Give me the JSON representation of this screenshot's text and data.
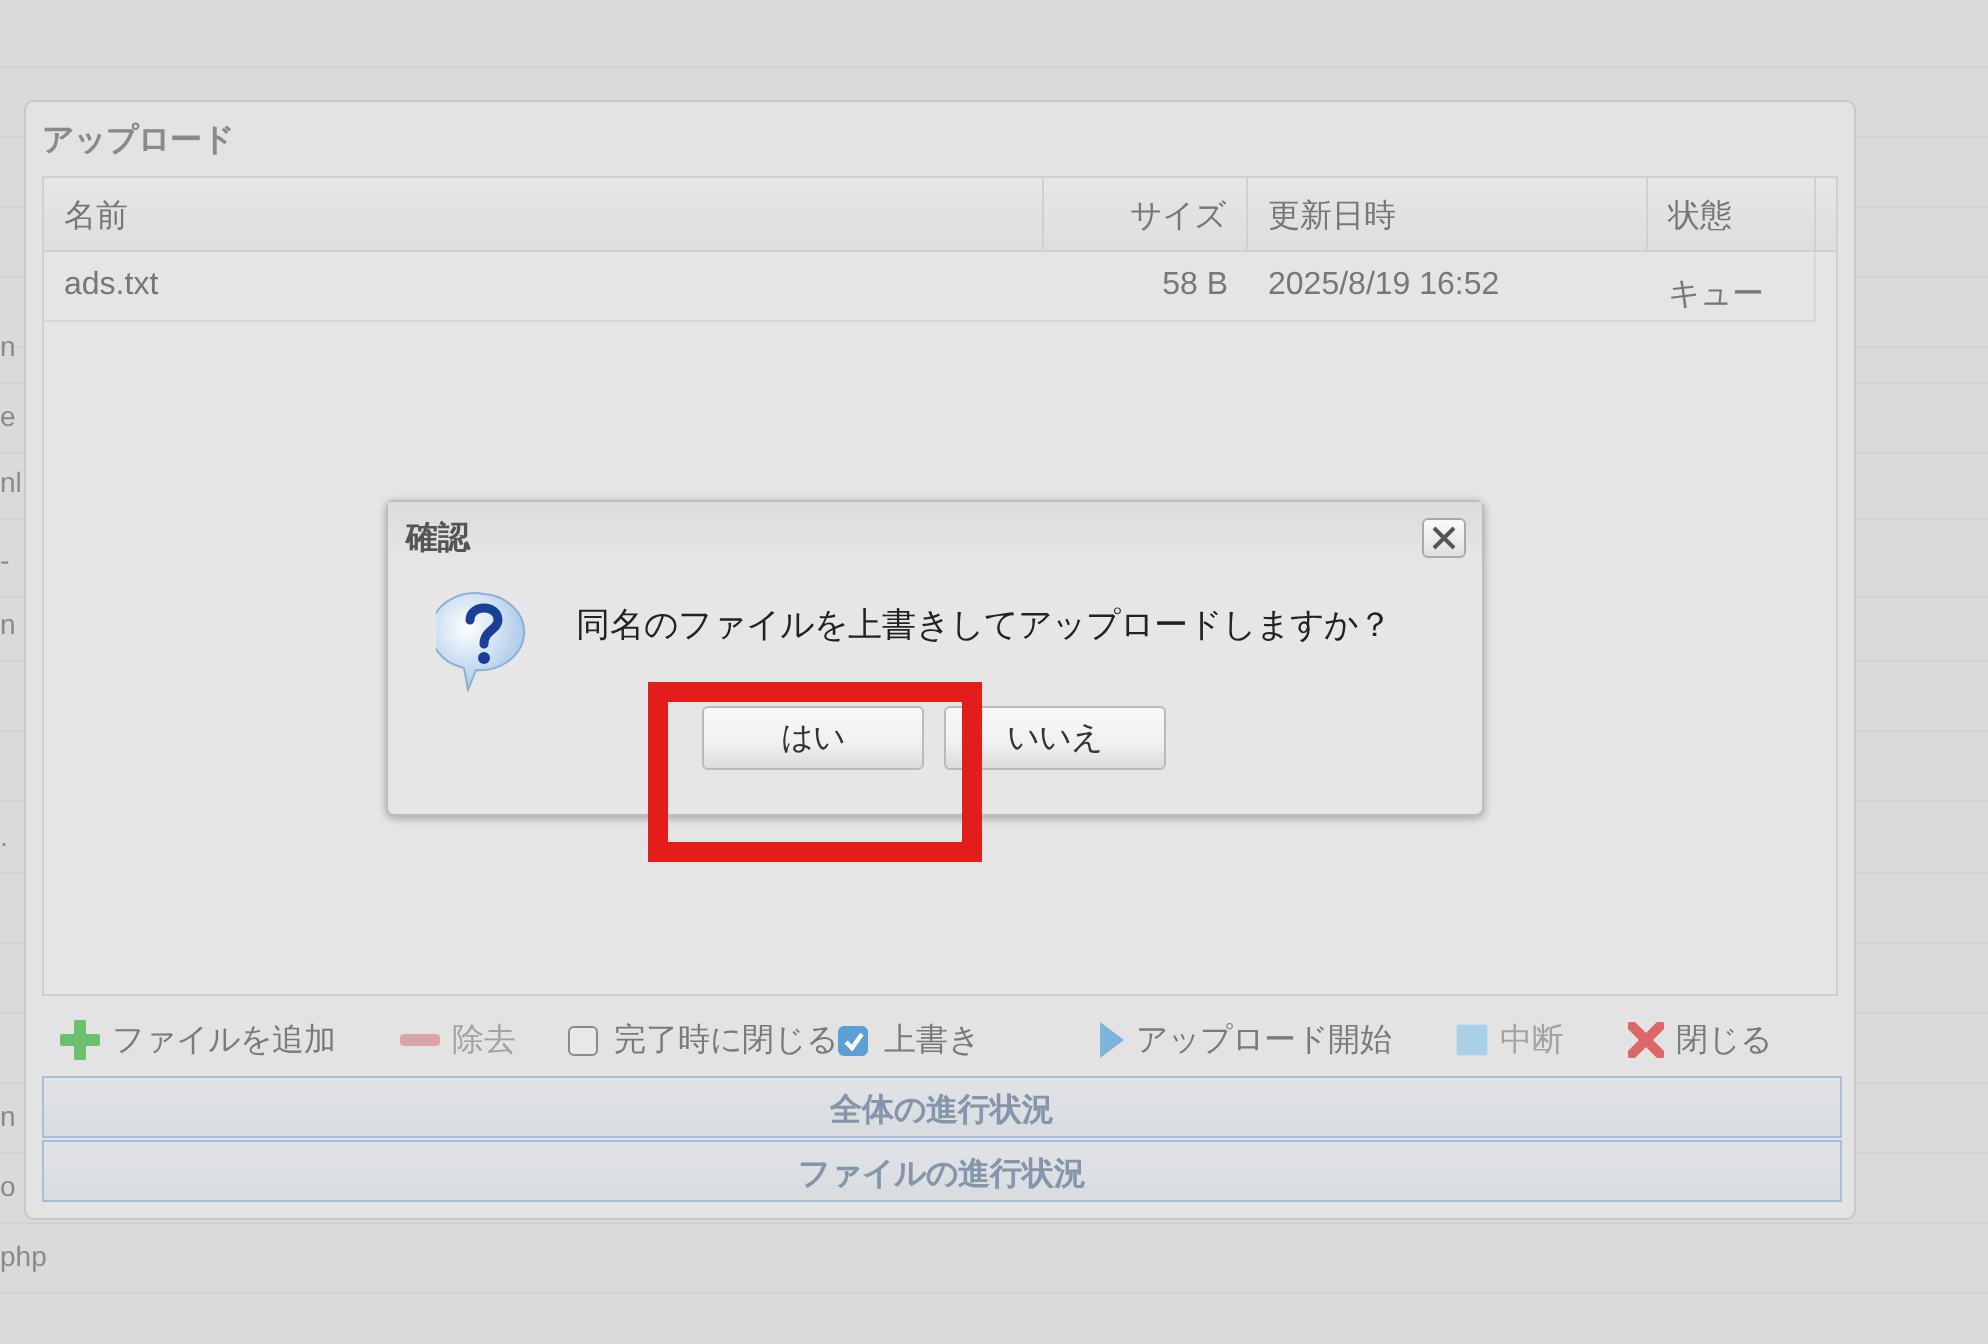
{
  "background_list": [
    {
      "text": "n"
    },
    {
      "text": "e"
    },
    {
      "text": "nl"
    },
    {
      "text": "-"
    },
    {
      "text": "n"
    },
    {
      "text": "."
    },
    {
      "text": "n"
    },
    {
      "text": "o"
    },
    {
      "text": "php"
    }
  ],
  "upload_dialog": {
    "title": "アップロード",
    "table": {
      "columns": [
        "名前",
        "サイズ",
        "更新日時",
        "状態"
      ],
      "rows": [
        {
          "name": "ads.txt",
          "size": "58 B",
          "modified": "2025/8/19 16:52",
          "status": "キュー"
        }
      ]
    },
    "toolbar": [
      {
        "kind": "button",
        "label": "ファイルを追加",
        "disabled": false
      },
      {
        "kind": "button",
        "label": "除去",
        "disabled": true
      },
      {
        "kind": "checkbox",
        "label": "完了時に閉じる",
        "checked": false
      },
      {
        "kind": "checkbox",
        "label": "上書き",
        "checked": true
      },
      {
        "kind": "button",
        "label": "アップロード開始",
        "disabled": false
      },
      {
        "kind": "button",
        "label": "中断",
        "disabled": true
      },
      {
        "kind": "button",
        "label": "閉じる",
        "disabled": false
      }
    ],
    "progress": [
      {
        "label": "全体の進行状況",
        "level": 0
      },
      {
        "label": "ファイルの進行状況",
        "level": 0
      }
    ]
  },
  "confirm_dialog": {
    "title": "確認",
    "message": "同名のファイルを上書きしてアップロードしますか？",
    "buttons": [
      {
        "label": "はい"
      },
      {
        "label": "いいえ"
      }
    ]
  }
}
